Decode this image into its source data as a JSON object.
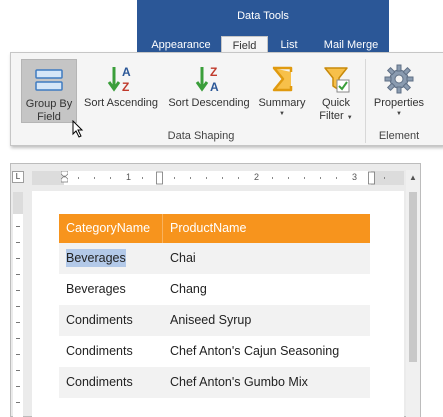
{
  "ribbon": {
    "context_title": "Data Tools",
    "tabs": [
      {
        "label": "Appearance",
        "active": false
      },
      {
        "label": "Field",
        "active": true
      },
      {
        "label": "List",
        "active": false
      },
      {
        "label": "Mail Merge",
        "active": false
      }
    ],
    "buttons": {
      "group_by_field": {
        "line1": "Group By",
        "line2": "Field",
        "icon": "group-by-field-icon"
      },
      "sort_ascending": {
        "label": "Sort Ascending",
        "icon": "sort-ascending-icon"
      },
      "sort_descending": {
        "label": "Sort Descending",
        "icon": "sort-descending-icon"
      },
      "summary": {
        "label": "Summary",
        "icon": "sigma-icon"
      },
      "quick_filter": {
        "line1": "Quick",
        "line2": "Filter",
        "icon": "funnel-icon"
      },
      "properties": {
        "label": "Properties",
        "icon": "gear-icon"
      }
    },
    "groups": {
      "data_shaping": "Data Shaping",
      "element": "Element"
    }
  },
  "ruler": {
    "corner": "L",
    "numbers": [
      "1",
      "2",
      "3"
    ]
  },
  "table": {
    "headers": [
      "CategoryName",
      "ProductName"
    ],
    "rows": [
      [
        "Beverages",
        "Chai"
      ],
      [
        "Beverages",
        "Chang"
      ],
      [
        "Condiments",
        "Aniseed Syrup"
      ],
      [
        "Condiments",
        "Chef Anton's Cajun Seasoning"
      ],
      [
        "Condiments",
        "Chef Anton's Gumbo Mix"
      ]
    ],
    "selected_cell": "Beverages"
  },
  "colors": {
    "ribbon_blue": "#2b5797",
    "header_orange": "#f7941d",
    "selection": "#b3c9e8"
  }
}
